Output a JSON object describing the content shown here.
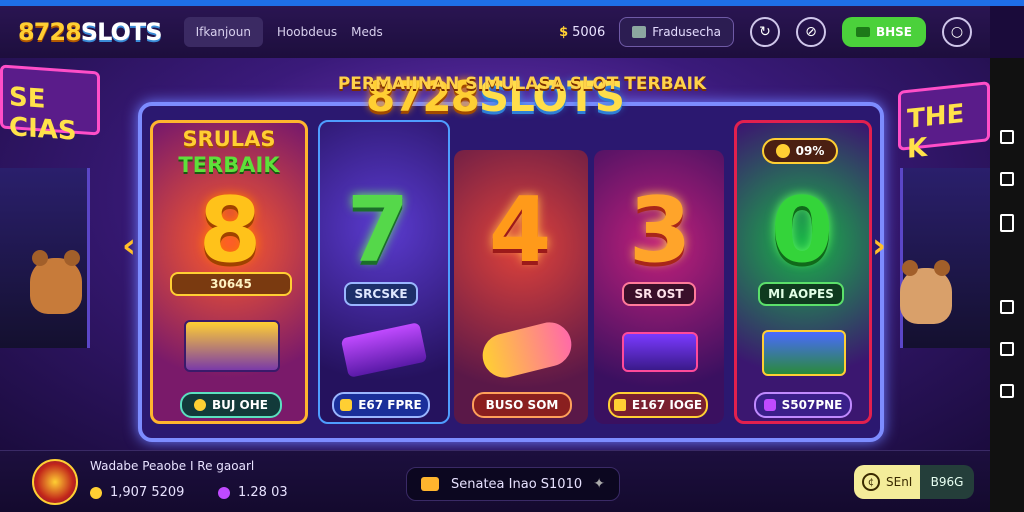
{
  "header": {
    "logo_num": "8728",
    "logo_word": "SLOTS",
    "nav_active": "Ifkanjoun",
    "nav_link_1": "Hoobdeus",
    "nav_link_2": "Meds",
    "balance": "5006",
    "promo": "Fradusecha",
    "green_label": "BHSE"
  },
  "hero": {
    "title_num": "8728",
    "title_word": "SLOTS",
    "subtitle": "PERMAIINAN SIMULASA SLOT TERBAIK",
    "neon_left": "SE CIAS",
    "neon_right": "THE K"
  },
  "panels": [
    {
      "title_a": "SRULAS",
      "title_b": "TERBAIK",
      "digit": "8",
      "tag": "30645",
      "button": "BUJ OHE"
    },
    {
      "digit": "7",
      "tag": "SRCSKE",
      "button": "E67 FPRE"
    },
    {
      "digit": "4",
      "button": "BUSO SOM"
    },
    {
      "digit": "3",
      "tag": "SR OST",
      "button": "E167 IOGE"
    },
    {
      "digit": "0",
      "badge": "09%",
      "tag": "MI AOPES",
      "button": "S507PNE"
    }
  ],
  "footer": {
    "user": "Wadabe Peaobe I Re gaoarl",
    "coins": "1,907 5209",
    "gems": "1.28 03",
    "notice": "Senatea Inao S1010",
    "claim_label": "SEnI",
    "claim_value": "B96G"
  },
  "colors": {
    "accent_gold": "#ffcf33",
    "accent_green": "#4bd13b",
    "background": "#1a0b3a"
  }
}
